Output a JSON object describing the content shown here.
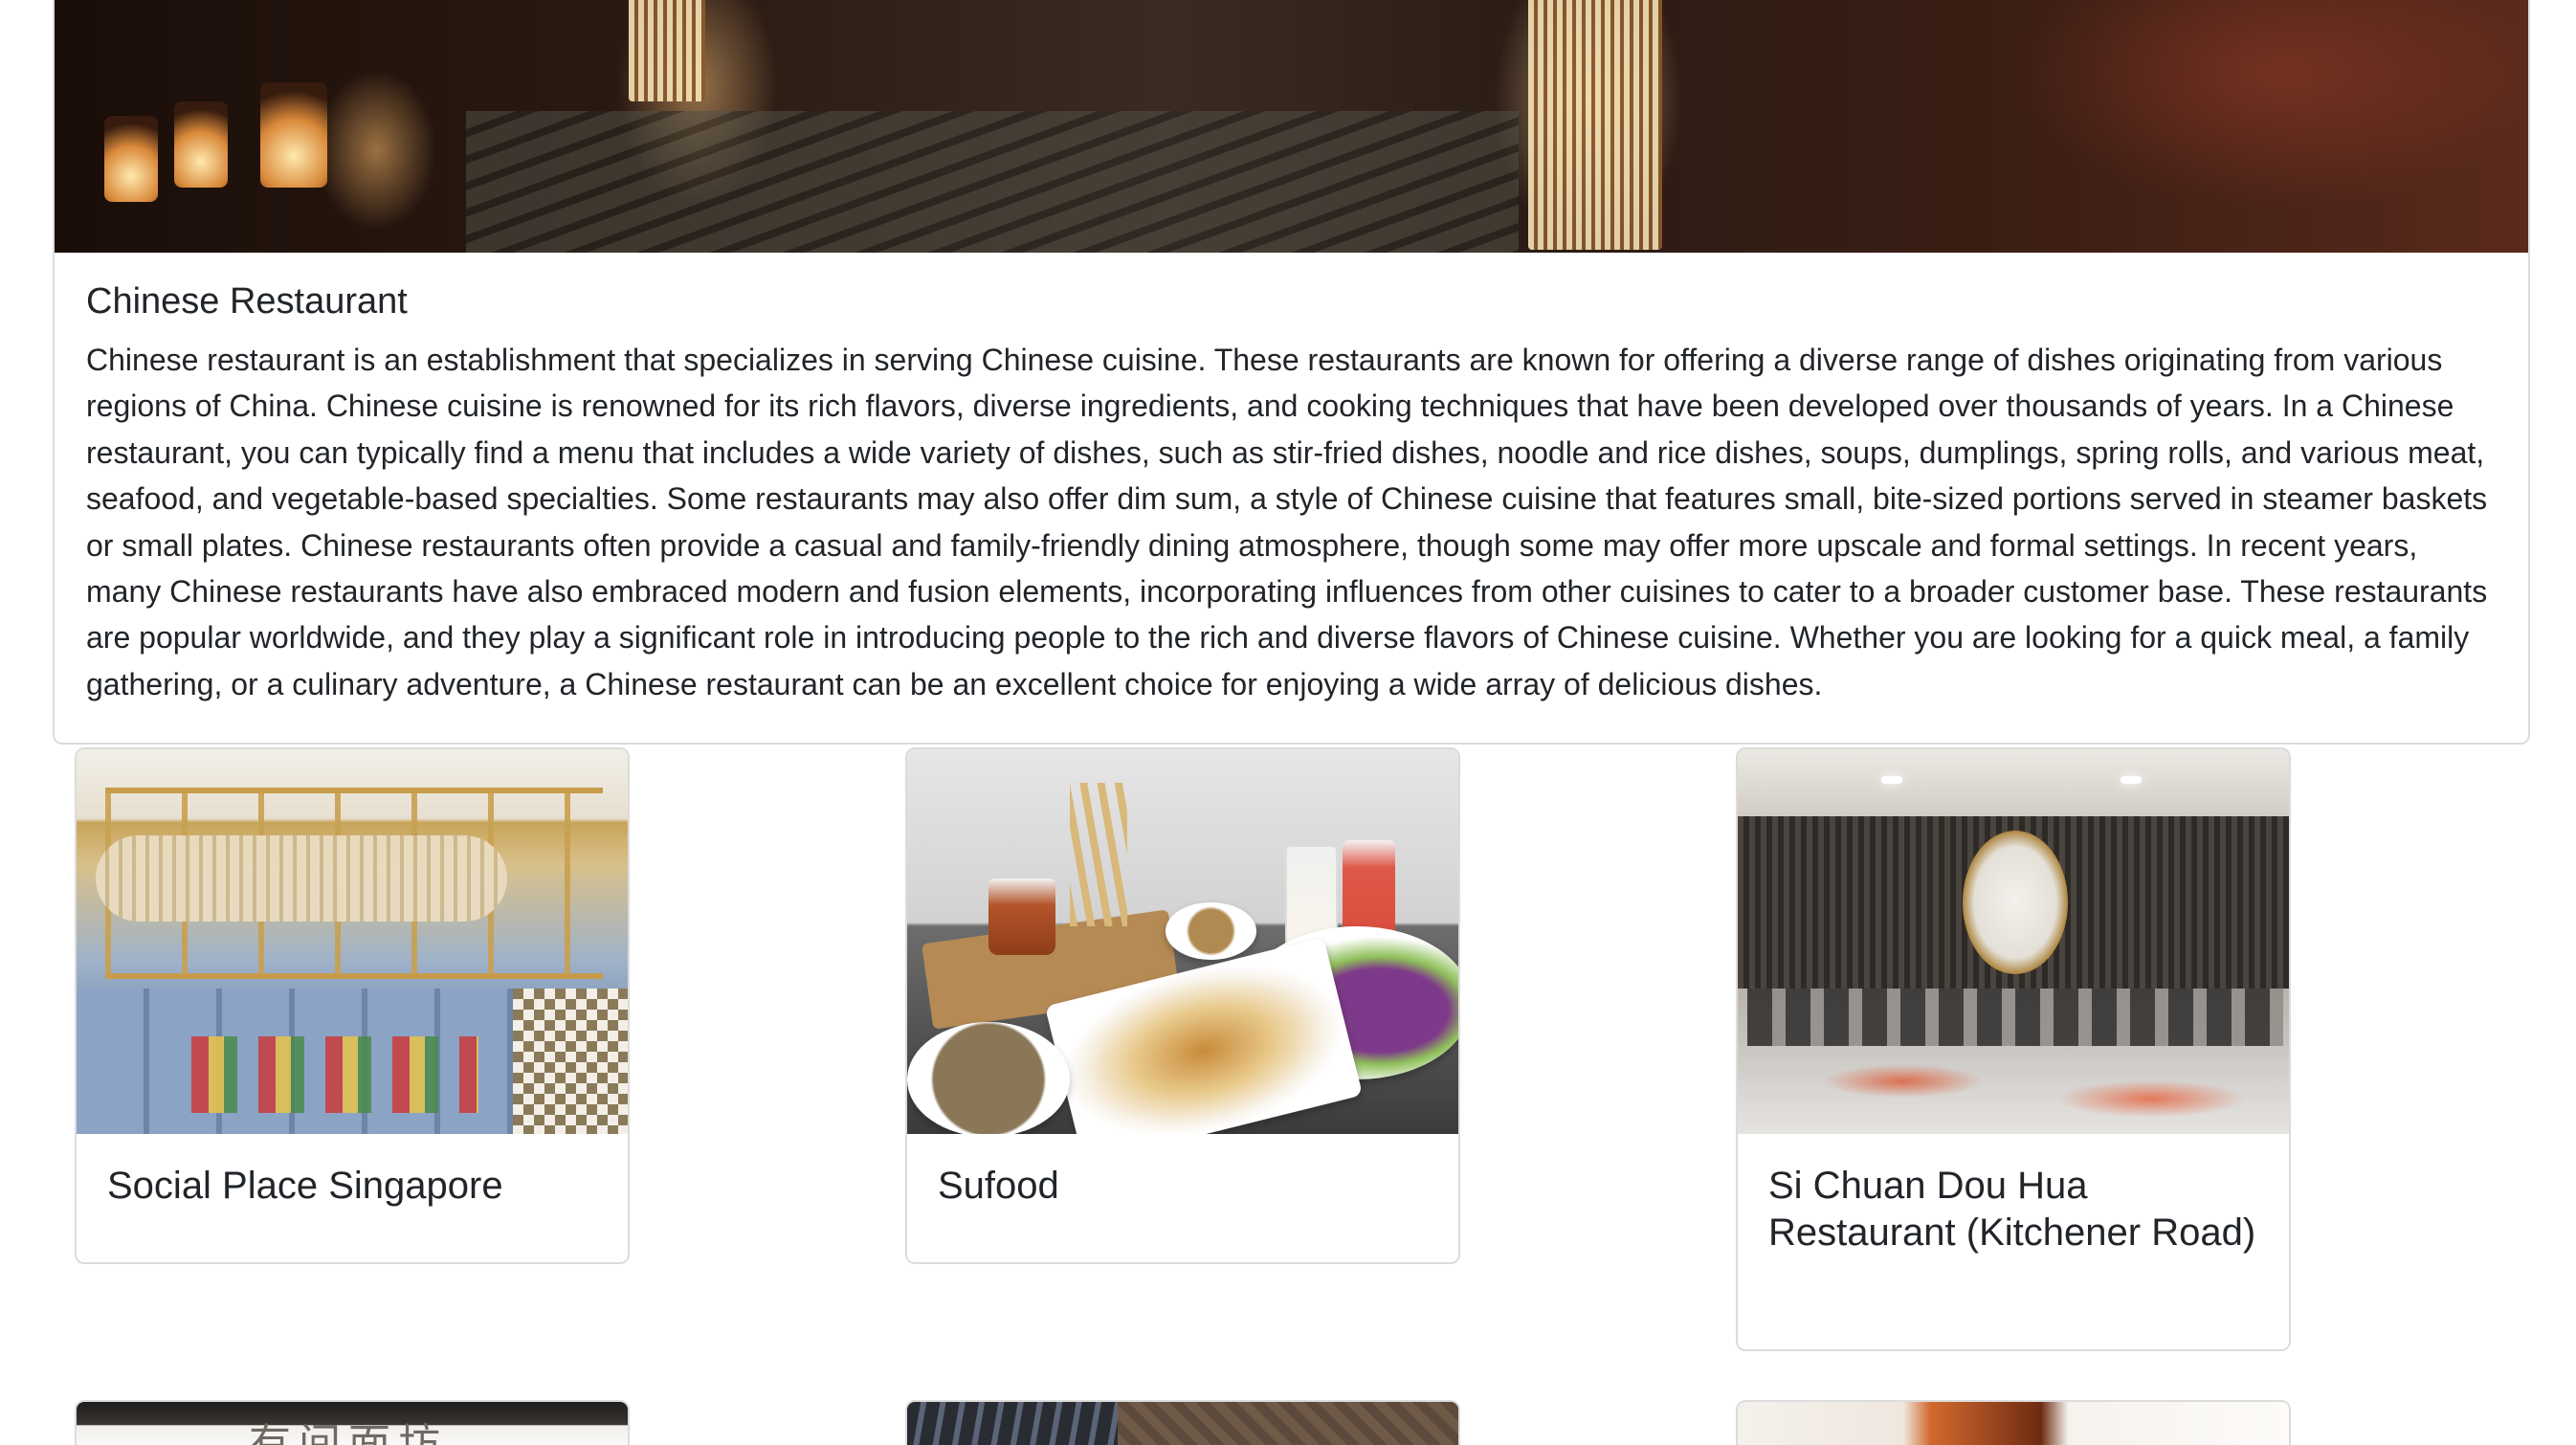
{
  "hero": {
    "title": "Chinese Restaurant",
    "description": "Chinese restaurant is an establishment that specializes in serving Chinese cuisine. These restaurants are known for offering a diverse range of dishes originating from various regions of China. Chinese cuisine is renowned for its rich flavors, diverse ingredients, and cooking techniques that have been developed over thousands of years. In a Chinese restaurant, you can typically find a menu that includes a wide variety of dishes, such as stir-fried dishes, noodle and rice dishes, soups, dumplings, spring rolls, and various meat, seafood, and vegetable-based specialties. Some restaurants may also offer dim sum, a style of Chinese cuisine that features small, bite-sized portions served in steamer baskets or small plates. Chinese restaurants often provide a casual and family-friendly dining atmosphere, though some may offer more upscale and formal settings. In recent years, many Chinese restaurants have also embraced modern and fusion elements, incorporating influences from other cuisines to cater to a broader customer base. These restaurants are popular worldwide, and they play a significant role in introducing people to the rich and diverse flavors of Chinese cuisine. Whether you are looking for a quick meal, a family gathering, or a culinary adventure, a Chinese restaurant can be an excellent choice for enjoying a wide array of delicious dishes."
  },
  "restaurants": [
    {
      "name": "Social Place Singapore"
    },
    {
      "name": "Sufood"
    },
    {
      "name": "Si Chuan Dou Hua Restaurant (Kitchener Road)"
    }
  ],
  "thumbnail_sign_text": "有间面坊",
  "colors": {
    "text": "#212529",
    "card_border": "#dcdcdc",
    "background": "#ffffff"
  }
}
